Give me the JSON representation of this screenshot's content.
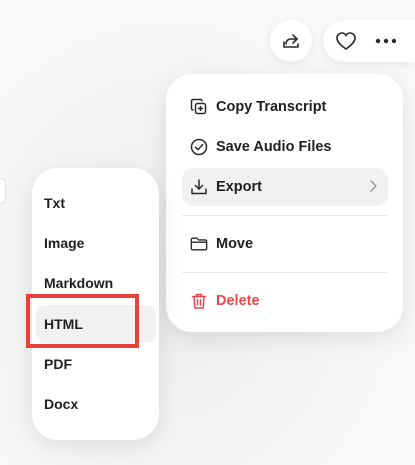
{
  "toolbar": {
    "share_icon": "share-icon",
    "like_icon": "heart-icon",
    "more_icon": "more-icon"
  },
  "menu": {
    "items": [
      {
        "label": "Copy Transcript",
        "icon": "copy-icon"
      },
      {
        "label": "Save Audio Files",
        "icon": "check-circle-icon"
      },
      {
        "label": "Export",
        "icon": "download-icon",
        "has_submenu": true,
        "active": true
      },
      {
        "label": "Move",
        "icon": "folder-icon"
      },
      {
        "label": "Delete",
        "icon": "trash-icon",
        "danger": true
      }
    ]
  },
  "export_submenu": {
    "items": [
      "Txt",
      "Image",
      "Markdown",
      "HTML",
      "PDF",
      "Docx"
    ],
    "highlighted": "HTML"
  },
  "colors": {
    "danger": "#e5484d",
    "annotation": "#e8413c",
    "hover_bg": "#f1f1f2"
  }
}
